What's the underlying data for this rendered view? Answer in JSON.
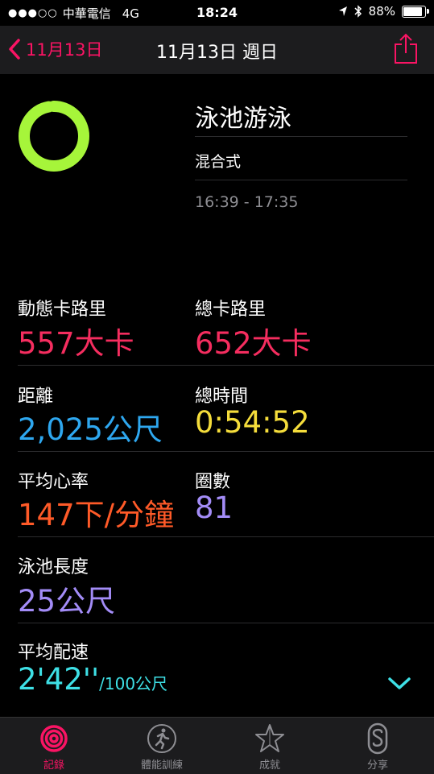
{
  "status_bar": {
    "carrier": "中華電信",
    "network": "4G",
    "time": "18:24",
    "battery": "88%",
    "battery_level": 0.88
  },
  "nav": {
    "back_label": "11月13日",
    "title": "11月13日 週日"
  },
  "workout": {
    "title": "泳池游泳",
    "type": "混合式",
    "time_range": "16:39 - 17:35",
    "ring_progress": 0.97
  },
  "metrics": {
    "active_cal": {
      "label": "動態卡路里",
      "value": "557大卡"
    },
    "total_cal": {
      "label": "總卡路里",
      "value": "652大卡"
    },
    "distance": {
      "label": "距離",
      "value": "2,025公尺"
    },
    "total_time": {
      "label": "總時間",
      "value": "0:54:52"
    },
    "avg_hr": {
      "label": "平均心率",
      "value": "147下/分鐘"
    },
    "laps": {
      "label": "圈數",
      "value": "81"
    },
    "pool_length": {
      "label": "泳池長度",
      "value": "25公尺"
    },
    "avg_pace": {
      "label": "平均配速",
      "value": "2'42''",
      "unit": "/100公尺"
    }
  },
  "tabs": [
    {
      "label": "記錄",
      "icon": "activity-rings-icon",
      "active": true
    },
    {
      "label": "體能訓練",
      "icon": "runner-icon",
      "active": false
    },
    {
      "label": "成就",
      "icon": "star-icon",
      "active": false
    },
    {
      "label": "分享",
      "icon": "sharing-icon",
      "active": false
    }
  ],
  "colors": {
    "accent": "#fa1464",
    "ring": "#a6f53a",
    "calorie": "#f52d5f",
    "distance": "#2ea7ef",
    "time": "#f5dd3b",
    "heart_rate": "#ff5a28",
    "laps": "#a38cf7",
    "pace": "#3ee0e6"
  }
}
